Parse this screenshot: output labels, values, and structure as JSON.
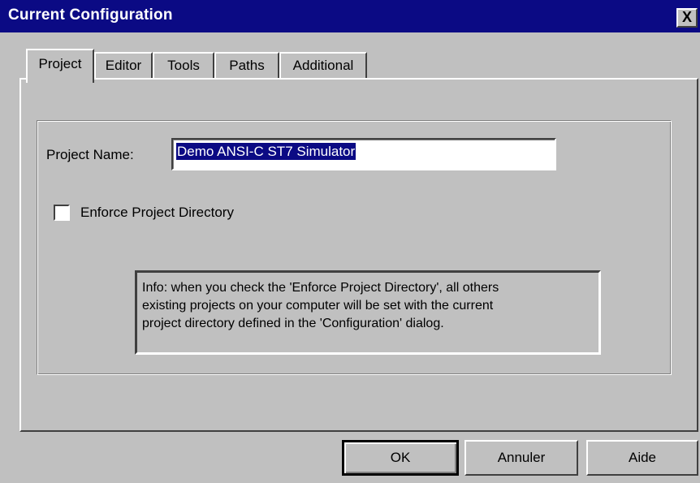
{
  "window": {
    "title": "Current Configuration",
    "close_glyph": "X"
  },
  "tabs": [
    {
      "label": "Project",
      "active": true
    },
    {
      "label": "Editor",
      "active": false
    },
    {
      "label": "Tools",
      "active": false
    },
    {
      "label": "Paths",
      "active": false
    },
    {
      "label": "Additional",
      "active": false
    }
  ],
  "project": {
    "name_label": "Project Name:",
    "name_value": "Demo ANSI-C ST7 Simulator",
    "enforce_label": "Enforce Project Directory",
    "enforce_checked": false,
    "info_text": "Info: when you check the 'Enforce Project Directory', all others\nexisting projects on your computer will be set with the current\nproject directory defined in the 'Configuration' dialog."
  },
  "buttons": {
    "ok": "OK",
    "cancel": "Annuler",
    "help": "Aide"
  },
  "colors": {
    "titlebar": "#0b0a84",
    "face": "#c0c0c0",
    "selection": "#0b0a84"
  }
}
